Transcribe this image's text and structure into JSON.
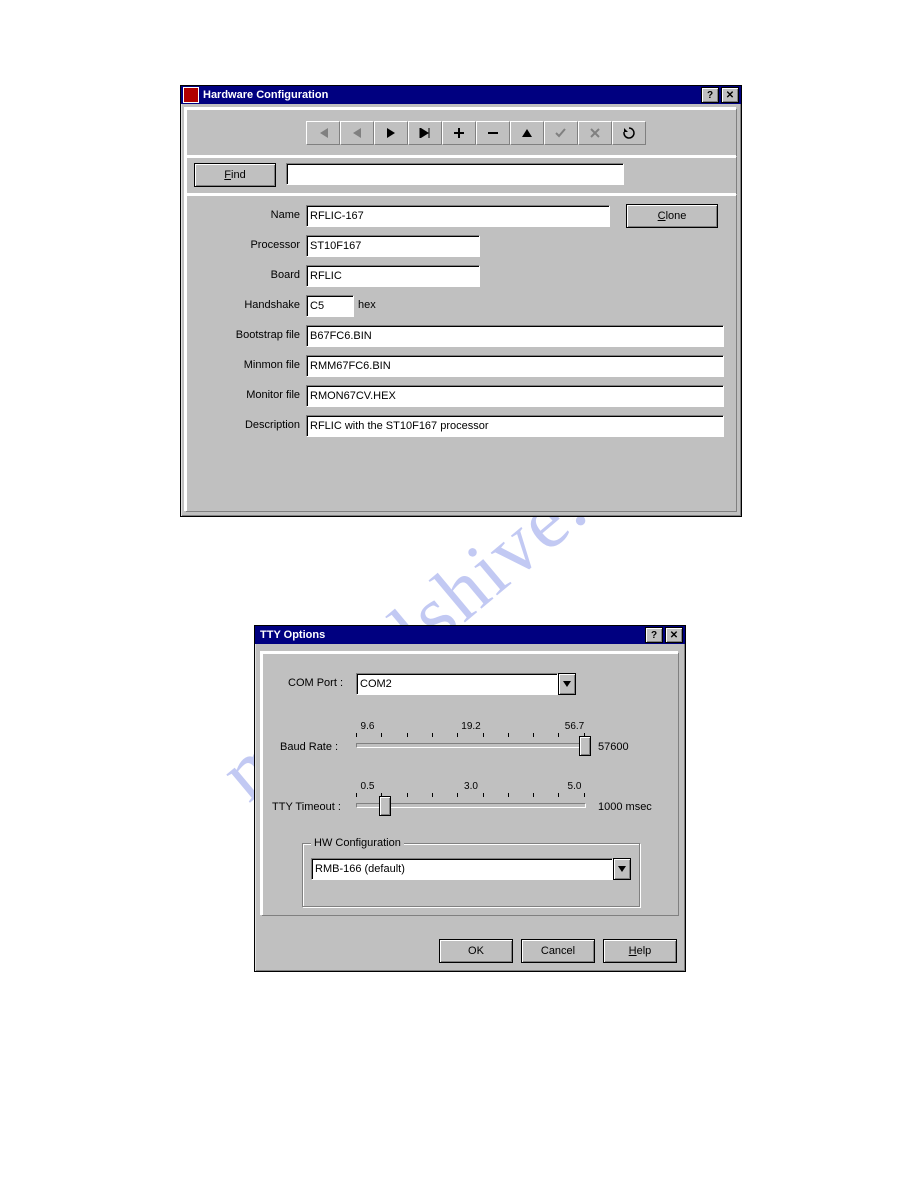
{
  "watermark": "manualshive.com",
  "hw": {
    "title": "Hardware Configuration",
    "toolbar": [
      "first",
      "prev",
      "play",
      "last",
      "add",
      "remove",
      "up",
      "apply",
      "cancel",
      "refresh"
    ],
    "findLabel": "Find",
    "findUnderline": "F",
    "cloneLabel": "Clone",
    "cloneUnderline": "C",
    "labels": {
      "name": "Name",
      "processor": "Processor",
      "board": "Board",
      "handshake": "Handshake",
      "hex": "hex",
      "bootstrap": "Bootstrap file",
      "minmon": "Minmon file",
      "monitor": "Monitor file",
      "description": "Description"
    },
    "values": {
      "name": "RFLIC-167",
      "processor": "ST10F167",
      "board": "RFLIC",
      "handshake": "C5",
      "bootstrap": "B67FC6.BIN",
      "minmon": "RMM67FC6.BIN",
      "monitor": "RMON67CV.HEX",
      "description": "RFLIC with the ST10F167 processor"
    }
  },
  "tty": {
    "title": "TTY Options",
    "comPortLabel": "COM Port :",
    "comPortValue": "COM2",
    "baudLabel": "Baud Rate :",
    "baudTicks": [
      "9.6",
      "19.2",
      "56.7"
    ],
    "baudValueLabel": "57600",
    "timeoutLabel": "TTY Timeout :",
    "timeoutTicks": [
      "0.5",
      "3.0",
      "5.0"
    ],
    "timeoutValueLabel": "1000 msec",
    "hwGroup": "HW Configuration",
    "hwValue": "RMB-166 (default)",
    "ok": "OK",
    "cancel": "Cancel",
    "help": "Help",
    "helpUnderline": "H"
  }
}
